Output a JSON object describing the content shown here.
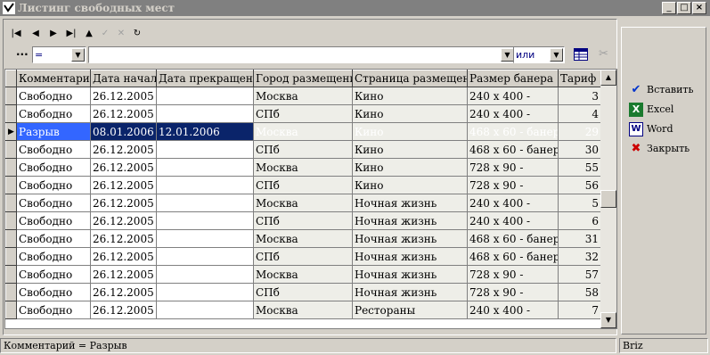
{
  "window": {
    "title": "Листинг свободных мест"
  },
  "filter": {
    "field_value": "=",
    "text_value": "",
    "logic_value": "или"
  },
  "grid": {
    "columns": [
      "Комментарий",
      "Дата начала",
      "Дата прекращения",
      "Город размещения",
      "Страница размещения",
      "Размер банера",
      "Тариф"
    ],
    "rows": [
      [
        "Свободно",
        "26.12.2005",
        "",
        "Москва",
        "Кино",
        "240 x 400  -",
        "3"
      ],
      [
        "Свободно",
        "26.12.2005",
        "",
        "СПб",
        "Кино",
        "240 x 400  -",
        "4"
      ],
      [
        "Разрыв",
        "08.01.2006",
        "12.01.2006",
        "Москва",
        "Кино",
        "468 x 60 - банер",
        "29"
      ],
      [
        "Свободно",
        "26.12.2005",
        "",
        "СПб",
        "Кино",
        "468 x 60 - банер",
        "30"
      ],
      [
        "Свободно",
        "26.12.2005",
        "",
        "Москва",
        "Кино",
        "728 x 90 -",
        "55"
      ],
      [
        "Свободно",
        "26.12.2005",
        "",
        "СПб",
        "Кино",
        "728 x 90 -",
        "56"
      ],
      [
        "Свободно",
        "26.12.2005",
        "",
        "Москва",
        "Ночная жизнь",
        "240 x 400  -",
        "5"
      ],
      [
        "Свободно",
        "26.12.2005",
        "",
        "СПб",
        "Ночная жизнь",
        "240 x 400  -",
        "6"
      ],
      [
        "Свободно",
        "26.12.2005",
        "",
        "Москва",
        "Ночная жизнь",
        "468 x 60 - банер",
        "31"
      ],
      [
        "Свободно",
        "26.12.2005",
        "",
        "СПб",
        "Ночная жизнь",
        "468 x 60 - банер",
        "32"
      ],
      [
        "Свободно",
        "26.12.2005",
        "",
        "Москва",
        "Ночная жизнь",
        "728 x 90 -",
        "57"
      ],
      [
        "Свободно",
        "26.12.2005",
        "",
        "СПб",
        "Ночная жизнь",
        "728 x 90 -",
        "58"
      ],
      [
        "Свободно",
        "26.12.2005",
        "",
        "Москва",
        "Рестораны",
        "240 x 400  -",
        "7"
      ]
    ],
    "selected_row": 2
  },
  "side": {
    "insert": "Вставить",
    "excel": "Excel",
    "word": "Word",
    "close": "Закрыть"
  },
  "status": {
    "text": "Комментарий = Разрыв",
    "app": "Briz"
  },
  "colors": {
    "selection": "#0a246a",
    "cell_selection": "#3366ff",
    "check_blue": "#0033cc",
    "close_red": "#cc0000"
  }
}
